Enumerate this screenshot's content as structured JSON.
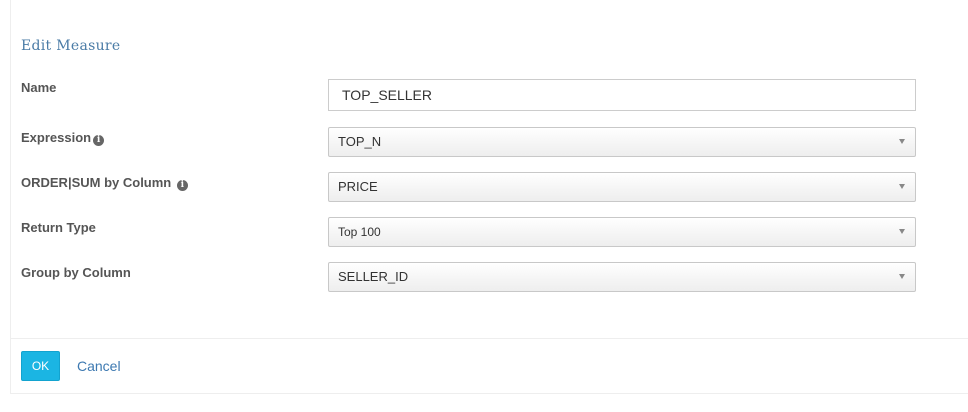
{
  "dialog": {
    "title": "Edit Measure",
    "fields": {
      "name": {
        "label": "Name",
        "value": "TOP_SELLER"
      },
      "expression": {
        "label": "Expression",
        "value": "TOP_N"
      },
      "order_column": {
        "label": "ORDER|SUM by Column",
        "value": "PRICE"
      },
      "return_type": {
        "label": "Return Type",
        "value": "Top 100"
      },
      "group_by": {
        "label": "Group by Column",
        "value": "SELLER_ID"
      }
    },
    "ok_label": "OK",
    "cancel_label": "Cancel"
  },
  "colors": {
    "accent": "#1bb5e3",
    "title": "#4a7ba6",
    "link": "#3d79b1"
  }
}
